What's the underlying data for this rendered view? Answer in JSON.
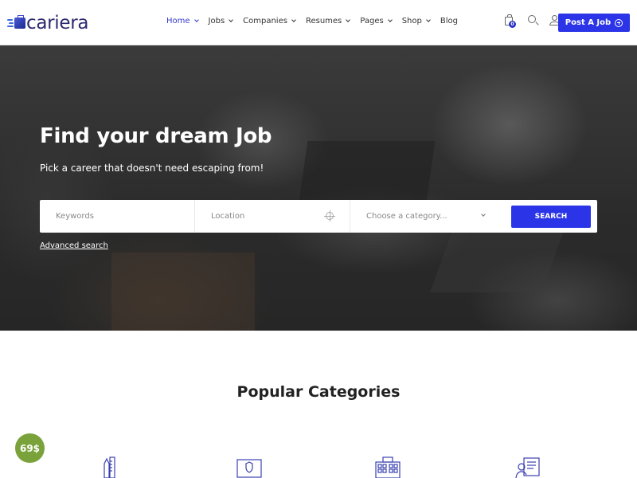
{
  "header": {
    "logo_text": "cariera",
    "nav": [
      {
        "label": "Home",
        "active": true,
        "has_dropdown": true
      },
      {
        "label": "Jobs",
        "active": false,
        "has_dropdown": true
      },
      {
        "label": "Companies",
        "active": false,
        "has_dropdown": true
      },
      {
        "label": "Resumes",
        "active": false,
        "has_dropdown": true
      },
      {
        "label": "Pages",
        "active": false,
        "has_dropdown": true
      },
      {
        "label": "Shop",
        "active": false,
        "has_dropdown": true
      },
      {
        "label": "Blog",
        "active": false,
        "has_dropdown": false
      }
    ],
    "icons": [
      "shopping-bag-icon",
      "search-icon",
      "user-icon"
    ],
    "cart_count": "0",
    "post_job_label": "Post A Job",
    "accent_color": "#2b34e6"
  },
  "hero": {
    "title": "Find your dream Job",
    "subtitle": "Pick a career that doesn't need escaping from!",
    "search": {
      "keywords_placeholder": "Keywords",
      "location_placeholder": "Location",
      "category_placeholder": "Choose a category...",
      "button_label": "SEARCH"
    },
    "advanced_search_label": "Advanced search"
  },
  "categories": {
    "title": "Popular Categories",
    "icons": [
      "design-tools-icon",
      "security-laptop-icon",
      "hospital-building-icon",
      "teacher-board-icon"
    ]
  },
  "price_badge": {
    "label": "69$",
    "color": "#7aa23a"
  }
}
